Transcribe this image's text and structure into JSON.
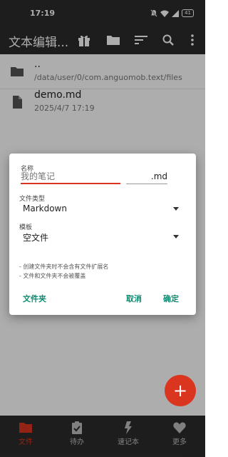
{
  "status_bar": {
    "time": "17:19",
    "battery": "41"
  },
  "app_bar": {
    "title": "文本编辑..."
  },
  "files": [
    {
      "name": "..",
      "subtitle": "/data/user/0/com.anguomob.text/files",
      "icon": "folder-icon"
    },
    {
      "name": "demo.md",
      "subtitle": "2025/4/7 17:19",
      "icon": "file-icon"
    }
  ],
  "dialog": {
    "name_label": "名称",
    "name_placeholder": "我的笔记",
    "extension": ".md",
    "type_label": "文件类型",
    "type_value": "Markdown",
    "template_label": "模板",
    "template_value": "空文件",
    "notes": [
      "- 创建文件夹时不会含有文件扩展名",
      "- 文件和文件夹不会被覆盖"
    ],
    "folder_button": "文件夹",
    "cancel_button": "取消",
    "ok_button": "确定"
  },
  "fab": {
    "label": "+"
  },
  "bottom_nav": [
    {
      "label": "文件",
      "icon": "folder-icon",
      "active": true
    },
    {
      "label": "待办",
      "icon": "clipboard-check-icon",
      "active": false
    },
    {
      "label": "速记本",
      "icon": "lightning-icon",
      "active": false
    },
    {
      "label": "更多",
      "icon": "heart-icon",
      "active": false
    }
  ],
  "colors": {
    "accent": "#d9351f",
    "button_text": "#0d8a70",
    "bar_background": "#2c2c2c"
  }
}
